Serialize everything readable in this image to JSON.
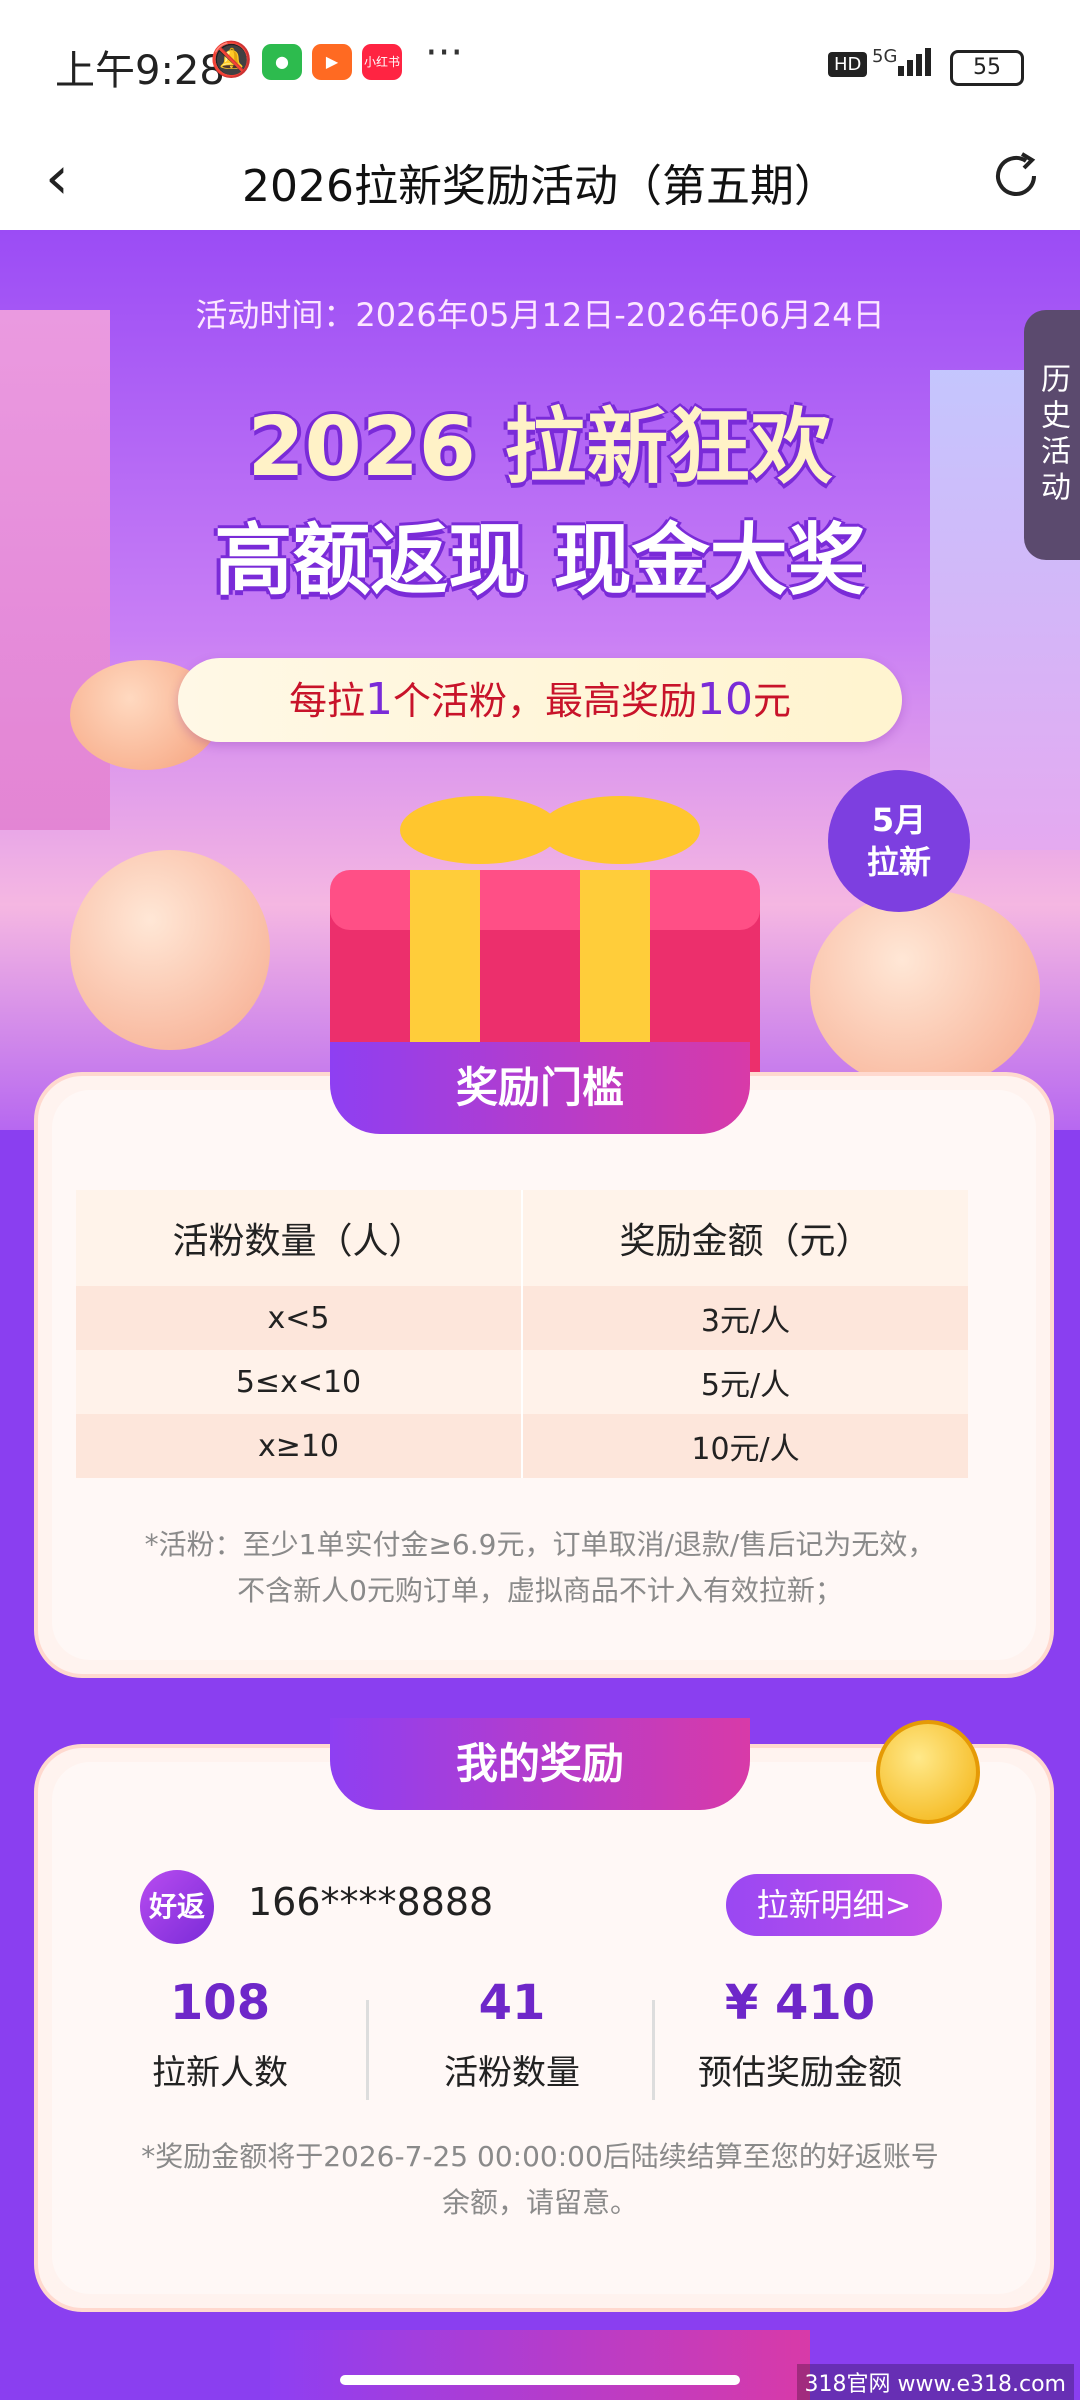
{
  "status_bar": {
    "time": "上午9:28",
    "app_icons": [
      "wechat-icon",
      "kuaishou-icon",
      "xiaohongshu-icon"
    ],
    "xiaohongshu_text": "小红书",
    "more": "···",
    "hd": "HD",
    "network": "5G",
    "battery": "55"
  },
  "nav": {
    "title": "2026拉新奖励活动（第五期）",
    "back_icon": "chevron-left-icon",
    "refresh_icon": "refresh-icon"
  },
  "hero": {
    "activity_time": "活动时间：2026年05月12日-2026年06月24日",
    "headline_1": "2026 拉新狂欢",
    "headline_2": "高额返现 现金大奖",
    "pill_pre": "每拉",
    "pill_num1": "1",
    "pill_mid": "个活粉，最高奖励",
    "pill_num2": "10",
    "pill_post": "元",
    "badge_line1": "5月",
    "badge_line2": "拉新",
    "history_tab": "历史活动"
  },
  "threshold": {
    "title": "奖励门槛",
    "headers": [
      "活粉数量（人）",
      "奖励金额（元）"
    ],
    "rows": [
      [
        "x<5",
        "3元/人"
      ],
      [
        "5≤x<10",
        "5元/人"
      ],
      [
        "x≥10",
        "10元/人"
      ]
    ],
    "note_1": "*活粉：至少1单实付金≥6.9元，订单取消/退款/售后记为无效，",
    "note_2": "不含新人0元购订单，虚拟商品不计入有效拉新；"
  },
  "my_reward": {
    "title": "我的奖励",
    "logo_text": "好返",
    "phone": "166****8888",
    "detail_button": "拉新明细>",
    "stats": [
      {
        "value": "108",
        "label": "拉新人数"
      },
      {
        "value": "41",
        "label": "活粉数量"
      },
      {
        "value": "¥ 410",
        "label": "预估奖励金额"
      }
    ],
    "note_1": "*奖励金额将于2026-7-25 00:00:00后陆续结算至您的好返账号",
    "note_2": "余额，请留意。"
  },
  "watermark": "318官网 www.e318.com"
}
